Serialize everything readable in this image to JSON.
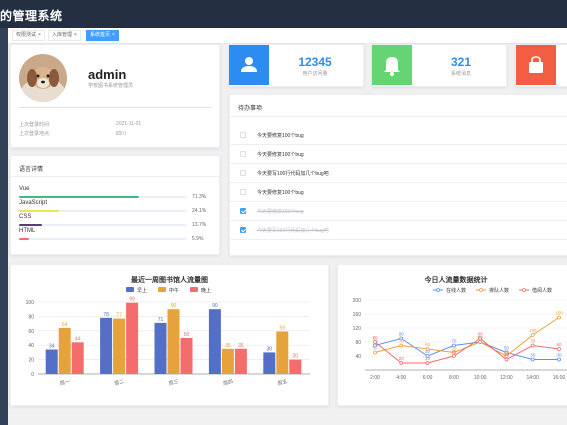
{
  "app": {
    "title": "的管理系统"
  },
  "tags": [
    {
      "label": "权限测试",
      "active": false
    },
    {
      "label": "入库管理",
      "active": false
    },
    {
      "label": "系统首页",
      "active": true
    }
  ],
  "user": {
    "name": "admin",
    "role": "学校图书系统管理员",
    "last_login_label": "上次登录时间:",
    "last_login_value": "2021-11-01",
    "last_location_label": "上次登录地点:",
    "last_location_value": "四川"
  },
  "languages": {
    "title": "语言详情",
    "items": [
      {
        "name": "Vue",
        "percent": "71.3%",
        "value": 71.3,
        "color": "#42b983"
      },
      {
        "name": "JavaScript",
        "percent": "24.1%",
        "value": 24.1,
        "color": "#f1e05a"
      },
      {
        "name": "CSS",
        "percent": "13.7%",
        "value": 13.7,
        "color": "#563d7c"
      },
      {
        "name": "HTML",
        "percent": "5.9%",
        "value": 5.9,
        "color": "#f56c6c"
      }
    ]
  },
  "stats": [
    {
      "value": "12345",
      "label": "用户访问量",
      "icon": "user-icon",
      "color": "#2d8cf0",
      "num_color": "#2d8cf0"
    },
    {
      "value": "321",
      "label": "系统消息",
      "icon": "bell-icon",
      "color": "#64d572",
      "num_color": "#2d8cf0"
    },
    {
      "value": "",
      "label": "",
      "icon": "shopping-bag-icon",
      "color": "#f25e43",
      "num_color": "#2d8cf0"
    }
  ],
  "todo": {
    "title": "待办事项",
    "items": [
      {
        "text": "今天要修复100个bug",
        "done": false
      },
      {
        "text": "今天要修复100个bug",
        "done": false
      },
      {
        "text": "今天要写100行代码加几个bug吧",
        "done": false
      },
      {
        "text": "今天要修复100个bug",
        "done": false
      },
      {
        "text": "今天要修复100个bug",
        "done": true
      },
      {
        "text": "今天要写100行代码加几个bug吧",
        "done": true
      }
    ]
  },
  "chart_data": [
    {
      "type": "bar",
      "title": "最近一周图书馆人流量图",
      "categories": [
        "周一",
        "周二",
        "周三",
        "周四",
        "周五"
      ],
      "series": [
        {
          "name": "早上",
          "color": "#5470c6",
          "values": [
            34,
            78,
            71,
            90,
            30
          ]
        },
        {
          "name": "中午",
          "color": "#e6a23c",
          "values": [
            64,
            77,
            90,
            35,
            59
          ]
        },
        {
          "name": "晚上",
          "color": "#f56c6c",
          "values": [
            44,
            99,
            50,
            35,
            20
          ]
        }
      ],
      "ylim": [
        0,
        100
      ],
      "yticks": [
        0,
        20,
        40,
        60,
        80,
        100
      ],
      "legend": "top-center",
      "grid": true
    },
    {
      "type": "line",
      "title": "今日人流量数据统计",
      "x": [
        "2:00",
        "4:00",
        "6:00",
        "8:00",
        "10:00",
        "12:00",
        "14:00",
        "16:00"
      ],
      "series": [
        {
          "name": "在线人数",
          "color": "#5b8ff9",
          "values": [
            70,
            90,
            40,
            70,
            80,
            50,
            30,
            30
          ]
        },
        {
          "name": "排队人数",
          "color": "#e6a23c",
          "values": [
            50,
            70,
            60,
            50,
            80,
            40,
            100,
            150
          ]
        },
        {
          "name": "借阅人数",
          "color": "#f56c6c",
          "values": [
            80,
            20,
            20,
            40,
            90,
            30,
            70,
            60
          ]
        }
      ],
      "ylim": [
        0,
        200
      ],
      "yticks": [
        40,
        80,
        120,
        160,
        200
      ],
      "legend": "top-center",
      "grid": true
    }
  ]
}
